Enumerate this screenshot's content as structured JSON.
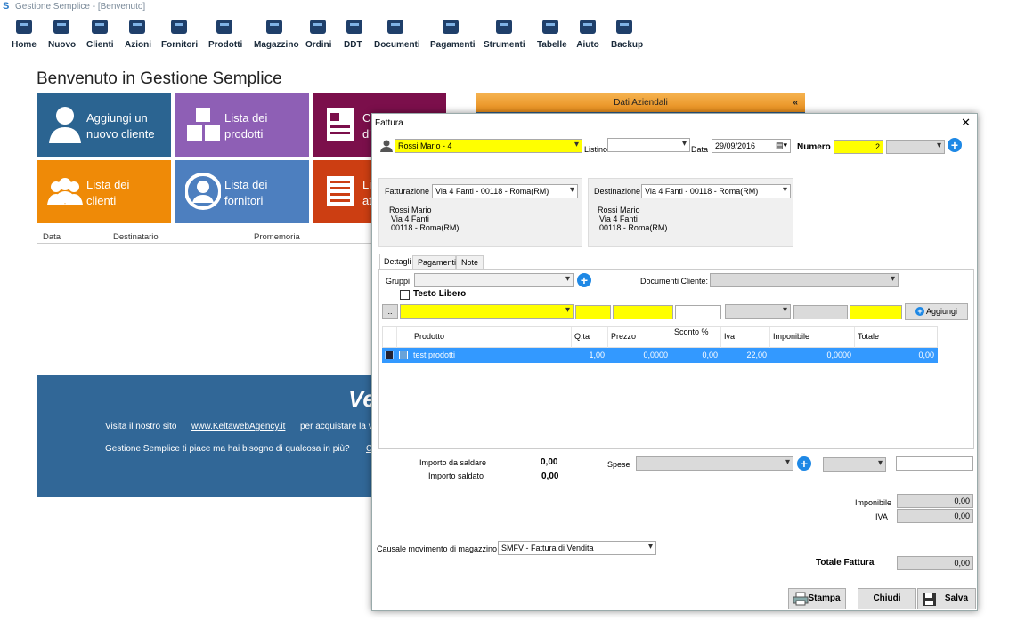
{
  "window": {
    "title": "Gestione Semplice - [Benvenuto]"
  },
  "toolbar": [
    {
      "label": "Home",
      "icon": "home-icon"
    },
    {
      "label": "Nuovo",
      "icon": "new-icon"
    },
    {
      "label": "Clienti",
      "icon": "customers-icon"
    },
    {
      "label": "Azioni",
      "icon": "calendar-icon"
    },
    {
      "label": "Fornitori",
      "icon": "suppliers-icon"
    },
    {
      "label": "Prodotti",
      "icon": "products-icon"
    },
    {
      "label": "Magazzino",
      "icon": "scale-icon"
    },
    {
      "label": "Ordini",
      "icon": "cart-icon"
    },
    {
      "label": "DDT",
      "icon": "truck-icon"
    },
    {
      "label": "Documenti",
      "icon": "documents-icon"
    },
    {
      "label": "Pagamenti",
      "icon": "money-icon"
    },
    {
      "label": "Strumenti",
      "icon": "tools-icon"
    },
    {
      "label": "Tabelle",
      "icon": "tables-icon"
    },
    {
      "label": "Aiuto",
      "icon": "help-icon"
    },
    {
      "label": "Backup",
      "icon": "cloud-icon"
    }
  ],
  "home": {
    "welcome": "Benvenuto in Gestione Semplice",
    "tiles": [
      {
        "line1": "Aggiungi un",
        "line2": "nuovo cliente",
        "color": "#2b6491"
      },
      {
        "line1": "Lista dei",
        "line2": "prodotti",
        "color": "#8e5fb5"
      },
      {
        "line1": "C",
        "line2": "d'",
        "color": "#7b0f4b"
      },
      {
        "line1": "Lista dei",
        "line2": "clienti",
        "color": "#ef8a07"
      },
      {
        "line1": "Lista dei",
        "line2": "fornitori",
        "color": "#4d7fbf"
      },
      {
        "line1": "Li",
        "line2": "at",
        "color": "#cc3e12"
      }
    ],
    "recent_headers": [
      "Data",
      "Destinatario",
      "Promemoria"
    ],
    "panel_title": "Dati Aziendali",
    "panel_chevron": "«",
    "banner_big": "Ve",
    "banner_line1_a": "Visita il nostro sito",
    "banner_link": "www.KeltawebAgency.it",
    "banner_line1_b": "per acquistare la v",
    "banner_line2": "Gestione Semplice ti piace ma hai bisogno di qualcosa in più?",
    "banner_line2_tail": "C"
  },
  "dialog": {
    "title": "Fattura",
    "close": "✕",
    "cliente": "Rossi Mario - 4",
    "listino_label": "Listino",
    "listino_value": "",
    "data_label": "Data",
    "data_value": "29/09/2016",
    "numero_label": "Numero",
    "numero_value": "2",
    "fatturazione_label": "Fatturazione",
    "fatturazione_value": "Via 4 Fanti - 00118 - Roma(RM)",
    "fatt_addr": [
      "Rossi Mario",
      "Via 4 Fanti",
      "00118 - Roma(RM)"
    ],
    "destinazione_label": "Destinazione",
    "destinazione_value": "Via 4 Fanti - 00118 - Roma(RM)",
    "dest_addr": [
      "Rossi Mario",
      "Via 4 Fanti",
      "00118 - Roma(RM)"
    ],
    "tabs": [
      "Dettagli",
      "Pagamenti",
      "Note"
    ],
    "gruppi_label": "Gruppi",
    "documenti_cliente_label": "Documenti Cliente:",
    "testo_libero_label": "Testo Libero",
    "dots_label": "..",
    "aggiungi_label": "Aggiungi",
    "table_headers": [
      "Prodotto",
      "Q.ta",
      "Prezzo",
      "Sconto %",
      "Iva",
      "Imponibile",
      "Totale"
    ],
    "rows": [
      {
        "prodotto": "test prodotti",
        "qta": "1,00",
        "prezzo": "0,0000",
        "sconto": "0,00",
        "iva": "22,00",
        "imponibile": "0,0000",
        "totale": "0,00"
      }
    ],
    "importo_da_saldare_label": "Importo da saldare",
    "importo_da_saldare_value": "0,00",
    "importo_saldato_label": "Importo saldato",
    "importo_saldato_value": "0,00",
    "spese_label": "Spese",
    "imponibile_label": "Imponibile",
    "imponibile_value": "0,00",
    "iva_label": "IVA",
    "iva_value": "0,00",
    "causale_label": "Causale movimento di magazzino *",
    "causale_value": "SMFV - Fattura di Vendita",
    "totale_label": "Totale Fattura",
    "totale_value": "0,00",
    "stampa_label": "Stampa",
    "chiudi_label": "Chiudi",
    "salva_label": "Salva"
  }
}
